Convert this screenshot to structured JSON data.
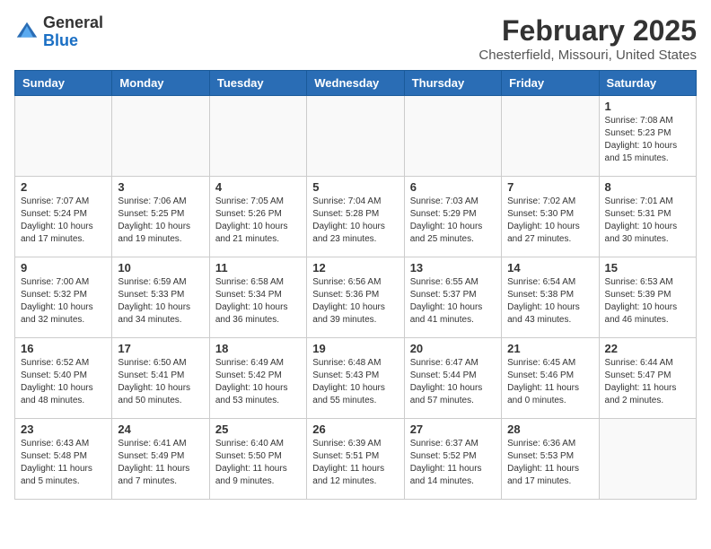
{
  "header": {
    "logo_general": "General",
    "logo_blue": "Blue",
    "month_title": "February 2025",
    "location": "Chesterfield, Missouri, United States"
  },
  "days_of_week": [
    "Sunday",
    "Monday",
    "Tuesday",
    "Wednesday",
    "Thursday",
    "Friday",
    "Saturday"
  ],
  "weeks": [
    [
      {
        "day": "",
        "info": ""
      },
      {
        "day": "",
        "info": ""
      },
      {
        "day": "",
        "info": ""
      },
      {
        "day": "",
        "info": ""
      },
      {
        "day": "",
        "info": ""
      },
      {
        "day": "",
        "info": ""
      },
      {
        "day": "1",
        "info": "Sunrise: 7:08 AM\nSunset: 5:23 PM\nDaylight: 10 hours and 15 minutes."
      }
    ],
    [
      {
        "day": "2",
        "info": "Sunrise: 7:07 AM\nSunset: 5:24 PM\nDaylight: 10 hours and 17 minutes."
      },
      {
        "day": "3",
        "info": "Sunrise: 7:06 AM\nSunset: 5:25 PM\nDaylight: 10 hours and 19 minutes."
      },
      {
        "day": "4",
        "info": "Sunrise: 7:05 AM\nSunset: 5:26 PM\nDaylight: 10 hours and 21 minutes."
      },
      {
        "day": "5",
        "info": "Sunrise: 7:04 AM\nSunset: 5:28 PM\nDaylight: 10 hours and 23 minutes."
      },
      {
        "day": "6",
        "info": "Sunrise: 7:03 AM\nSunset: 5:29 PM\nDaylight: 10 hours and 25 minutes."
      },
      {
        "day": "7",
        "info": "Sunrise: 7:02 AM\nSunset: 5:30 PM\nDaylight: 10 hours and 27 minutes."
      },
      {
        "day": "8",
        "info": "Sunrise: 7:01 AM\nSunset: 5:31 PM\nDaylight: 10 hours and 30 minutes."
      }
    ],
    [
      {
        "day": "9",
        "info": "Sunrise: 7:00 AM\nSunset: 5:32 PM\nDaylight: 10 hours and 32 minutes."
      },
      {
        "day": "10",
        "info": "Sunrise: 6:59 AM\nSunset: 5:33 PM\nDaylight: 10 hours and 34 minutes."
      },
      {
        "day": "11",
        "info": "Sunrise: 6:58 AM\nSunset: 5:34 PM\nDaylight: 10 hours and 36 minutes."
      },
      {
        "day": "12",
        "info": "Sunrise: 6:56 AM\nSunset: 5:36 PM\nDaylight: 10 hours and 39 minutes."
      },
      {
        "day": "13",
        "info": "Sunrise: 6:55 AM\nSunset: 5:37 PM\nDaylight: 10 hours and 41 minutes."
      },
      {
        "day": "14",
        "info": "Sunrise: 6:54 AM\nSunset: 5:38 PM\nDaylight: 10 hours and 43 minutes."
      },
      {
        "day": "15",
        "info": "Sunrise: 6:53 AM\nSunset: 5:39 PM\nDaylight: 10 hours and 46 minutes."
      }
    ],
    [
      {
        "day": "16",
        "info": "Sunrise: 6:52 AM\nSunset: 5:40 PM\nDaylight: 10 hours and 48 minutes."
      },
      {
        "day": "17",
        "info": "Sunrise: 6:50 AM\nSunset: 5:41 PM\nDaylight: 10 hours and 50 minutes."
      },
      {
        "day": "18",
        "info": "Sunrise: 6:49 AM\nSunset: 5:42 PM\nDaylight: 10 hours and 53 minutes."
      },
      {
        "day": "19",
        "info": "Sunrise: 6:48 AM\nSunset: 5:43 PM\nDaylight: 10 hours and 55 minutes."
      },
      {
        "day": "20",
        "info": "Sunrise: 6:47 AM\nSunset: 5:44 PM\nDaylight: 10 hours and 57 minutes."
      },
      {
        "day": "21",
        "info": "Sunrise: 6:45 AM\nSunset: 5:46 PM\nDaylight: 11 hours and 0 minutes."
      },
      {
        "day": "22",
        "info": "Sunrise: 6:44 AM\nSunset: 5:47 PM\nDaylight: 11 hours and 2 minutes."
      }
    ],
    [
      {
        "day": "23",
        "info": "Sunrise: 6:43 AM\nSunset: 5:48 PM\nDaylight: 11 hours and 5 minutes."
      },
      {
        "day": "24",
        "info": "Sunrise: 6:41 AM\nSunset: 5:49 PM\nDaylight: 11 hours and 7 minutes."
      },
      {
        "day": "25",
        "info": "Sunrise: 6:40 AM\nSunset: 5:50 PM\nDaylight: 11 hours and 9 minutes."
      },
      {
        "day": "26",
        "info": "Sunrise: 6:39 AM\nSunset: 5:51 PM\nDaylight: 11 hours and 12 minutes."
      },
      {
        "day": "27",
        "info": "Sunrise: 6:37 AM\nSunset: 5:52 PM\nDaylight: 11 hours and 14 minutes."
      },
      {
        "day": "28",
        "info": "Sunrise: 6:36 AM\nSunset: 5:53 PM\nDaylight: 11 hours and 17 minutes."
      },
      {
        "day": "",
        "info": ""
      }
    ]
  ]
}
